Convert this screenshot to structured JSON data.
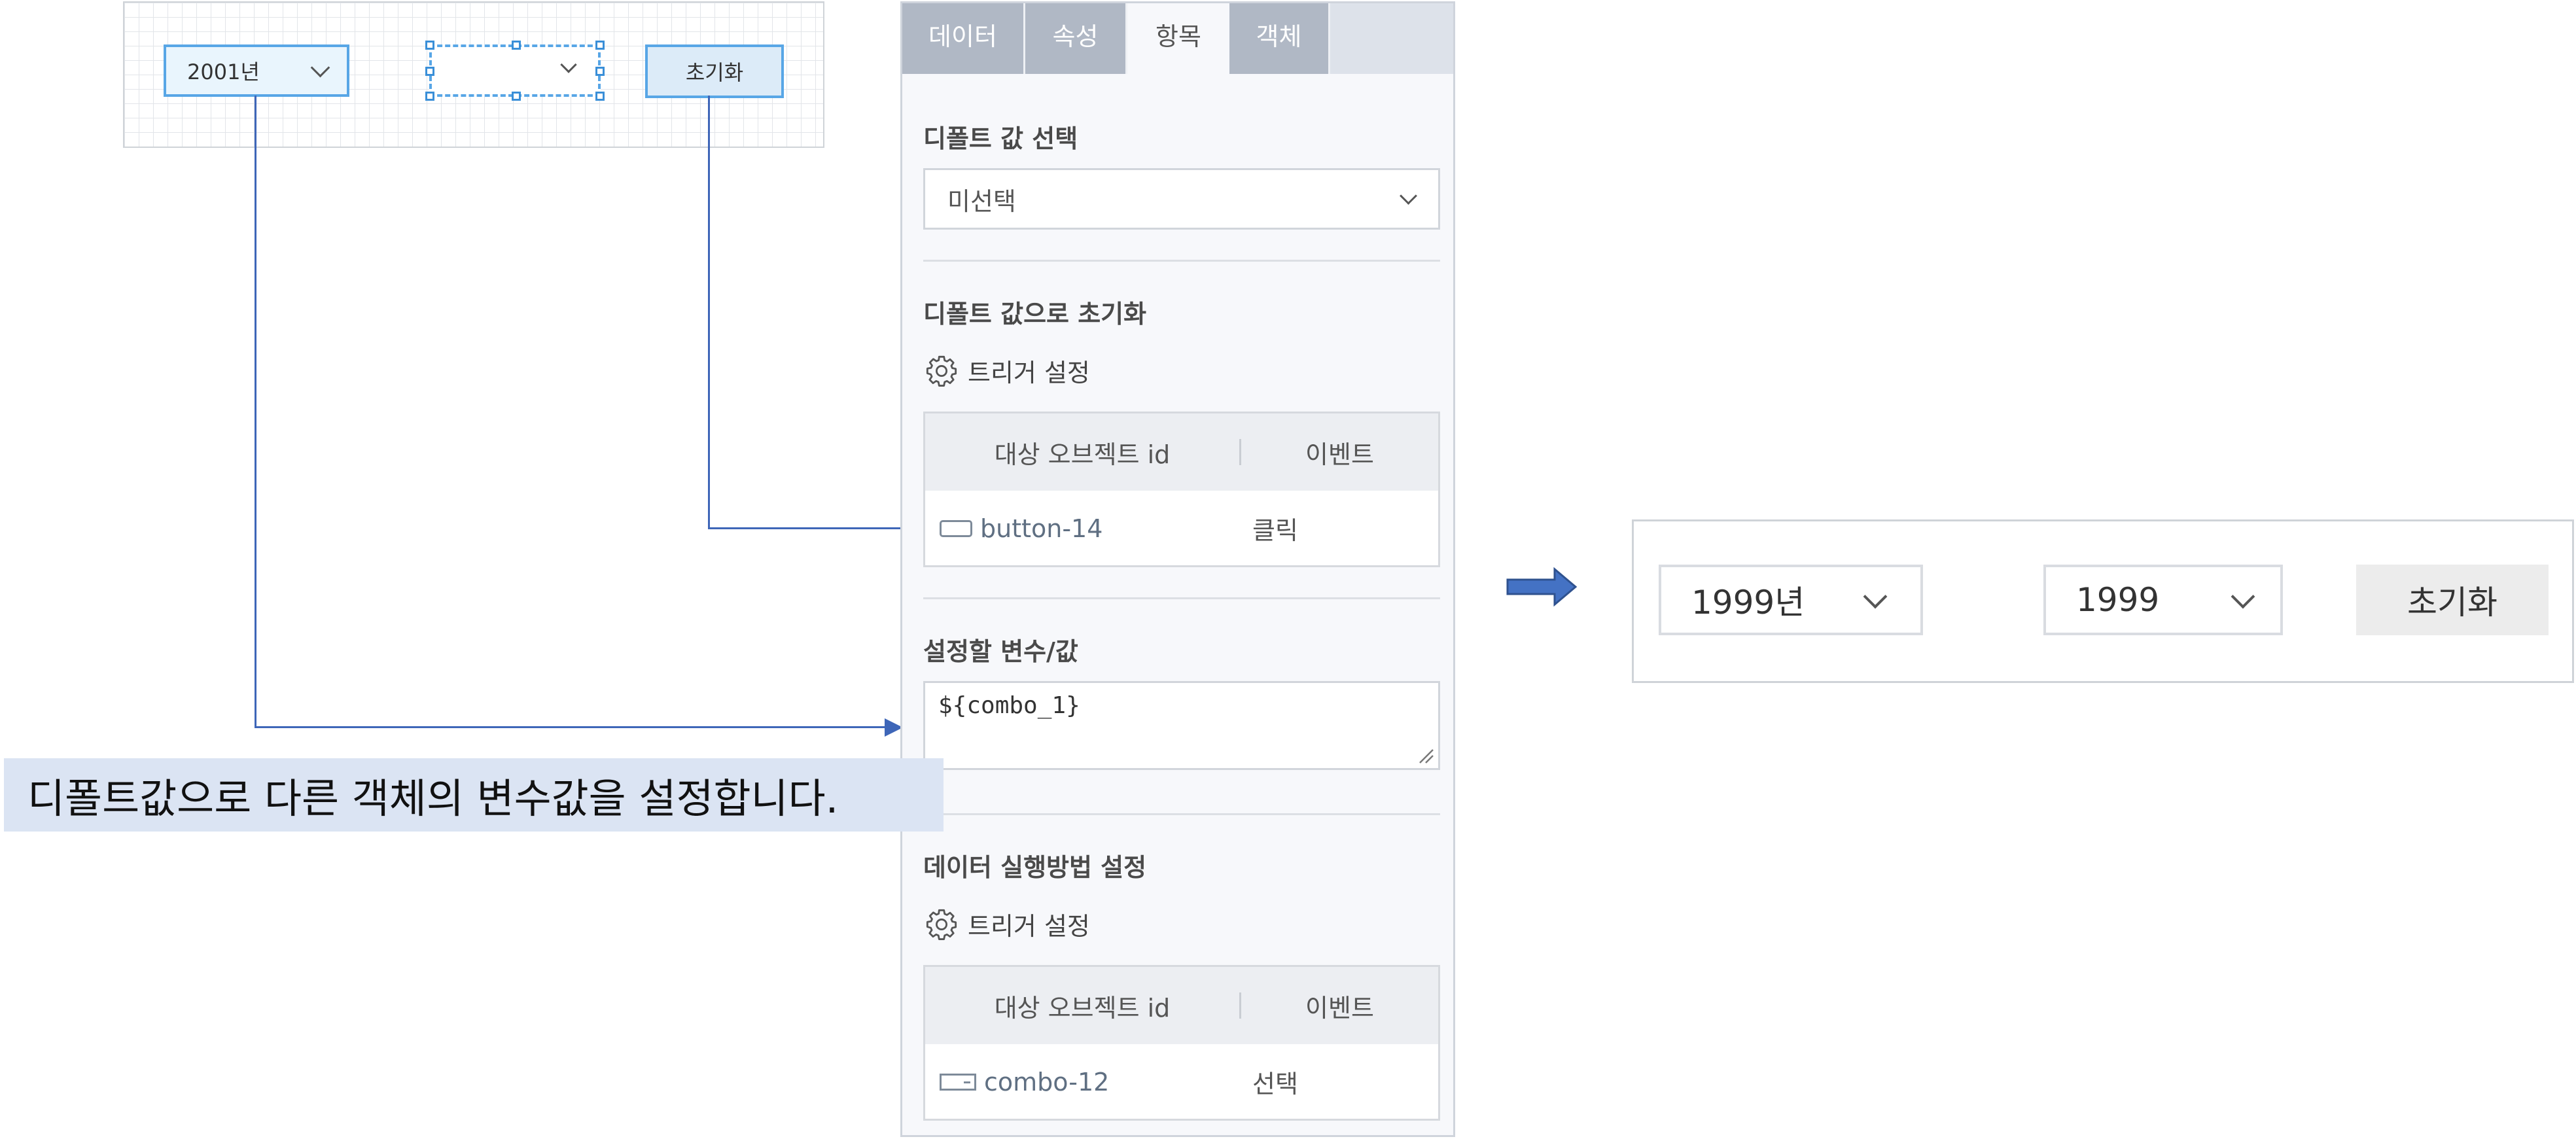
{
  "canvas": {
    "year_combo_value": "2001년",
    "reset_button_label": "초기화"
  },
  "panel": {
    "tabs": [
      {
        "label": "데이터",
        "active": false
      },
      {
        "label": "속성",
        "active": false
      },
      {
        "label": "항목",
        "active": true
      },
      {
        "label": "객체",
        "active": false
      }
    ],
    "default_value": {
      "title": "디폴트 값 선택",
      "selected": "미선택"
    },
    "reset_to_default": {
      "title": "디폴트 값으로 초기화",
      "trigger_label": "트리거 설정",
      "table_header": {
        "object_id": "대상 오브젝트 id",
        "event": "이벤트"
      },
      "rows": [
        {
          "object_id": "button-14",
          "event": "클릭",
          "icon": "button-icon"
        }
      ]
    },
    "variable": {
      "title": "설정할 변수/값",
      "value": "${combo_1}"
    },
    "data_execution": {
      "title": "데이터 실행방법 설정",
      "trigger_label": "트리거 설정",
      "table_header": {
        "object_id": "대상 오브젝트 id",
        "event": "이벤트"
      },
      "rows": [
        {
          "object_id": "combo-12",
          "event": "선택",
          "icon": "combo-icon"
        }
      ]
    }
  },
  "note": "디폴트값으로 다른 객체의 변수값을 설정합니다.",
  "result": {
    "combo1_value": "1999년",
    "combo2_value": "1999",
    "reset_button_label": "초기화"
  },
  "colors": {
    "connector": "#3e66b8",
    "selection": "#58a6e6",
    "note_bg": "#dbe4f3"
  }
}
